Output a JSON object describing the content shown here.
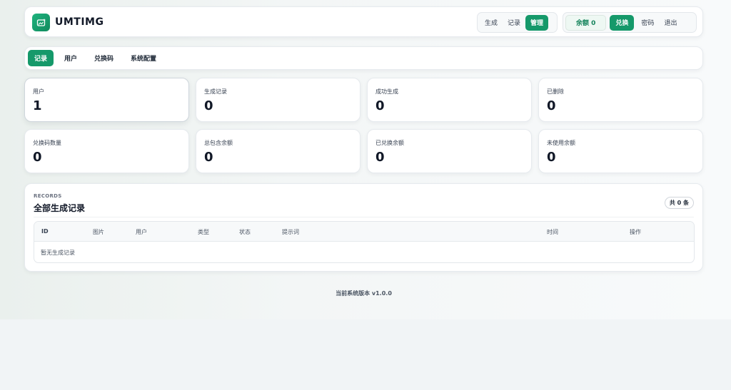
{
  "header": {
    "brand": "UMTIMG",
    "nav": [
      {
        "label": "生成"
      },
      {
        "label": "记录"
      },
      {
        "label": "管理"
      }
    ],
    "balance": "余额 0",
    "redeem": "兑换",
    "secret": "密码",
    "logout": "退出"
  },
  "tabs": [
    {
      "label": "记录"
    },
    {
      "label": "用户"
    },
    {
      "label": "兑换码"
    },
    {
      "label": "系统配置"
    }
  ],
  "stats": [
    {
      "label": "用户",
      "value": "1"
    },
    {
      "label": "生成记录",
      "value": "0"
    },
    {
      "label": "成功生成",
      "value": "0"
    },
    {
      "label": "已删除",
      "value": "0"
    },
    {
      "label": "兑换码数量",
      "value": "0"
    },
    {
      "label": "总包含余额",
      "value": "0"
    },
    {
      "label": "已兑换余额",
      "value": "0"
    },
    {
      "label": "未使用余额",
      "value": "0"
    }
  ],
  "records": {
    "eyebrow": "RECORDS",
    "title": "全部生成记录",
    "count": "共 0 条",
    "columns": [
      "ID",
      "图片",
      "用户",
      "类型",
      "状态",
      "提示词",
      "时间",
      "操作"
    ],
    "empty": "暂无生成记录"
  },
  "footer": {
    "version": "当前系统版本 v1.0.0"
  },
  "colors": {
    "accent": "#15996a",
    "background": "#f1f4f6"
  }
}
